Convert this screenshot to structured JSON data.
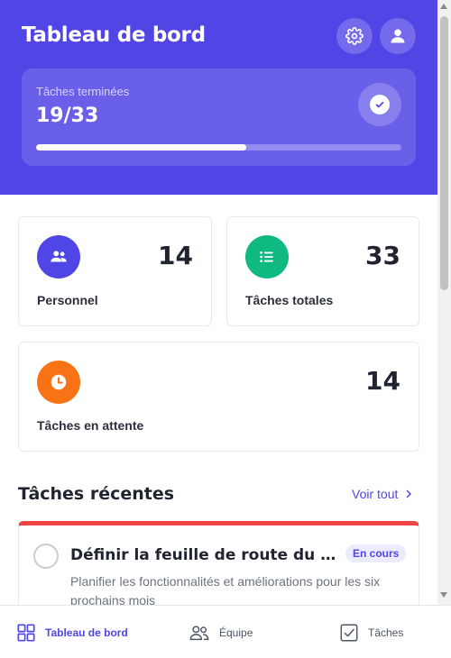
{
  "header": {
    "title": "Tableau de bord",
    "settings_icon": "gear-icon",
    "profile_icon": "user-icon",
    "progress": {
      "label": "Tâches terminées",
      "value": "19/33",
      "fraction": 0.576,
      "icon": "check-circle-icon"
    }
  },
  "stats": [
    {
      "label": "Personnel",
      "value": "14",
      "icon": "users-icon",
      "color": "#4f46e5"
    },
    {
      "label": "Tâches totales",
      "value": "33",
      "icon": "list-icon",
      "color": "#10b981"
    },
    {
      "label": "Tâches en attente",
      "value": "14",
      "icon": "clock-icon",
      "color": "#f97316"
    }
  ],
  "recent": {
    "title": "Tâches récentes",
    "see_all": "Voir tout"
  },
  "tasks": [
    {
      "title": "Définir la feuille de route du produit",
      "status": "En cours",
      "description": "Planifier les fonctionnalités et améliorations pour les six prochains mois",
      "priority_color": "#ef4444"
    }
  ],
  "nav": [
    {
      "label": "Tableau de bord",
      "icon": "dashboard-icon",
      "active": true
    },
    {
      "label": "Équipe",
      "icon": "team-icon",
      "active": false
    },
    {
      "label": "Tâches",
      "icon": "tasks-icon",
      "active": false
    }
  ],
  "colors": {
    "brand": "#5245e6",
    "accent": "#4f46e5",
    "success": "#10b981",
    "warning": "#f97316",
    "danger": "#ef4444"
  }
}
